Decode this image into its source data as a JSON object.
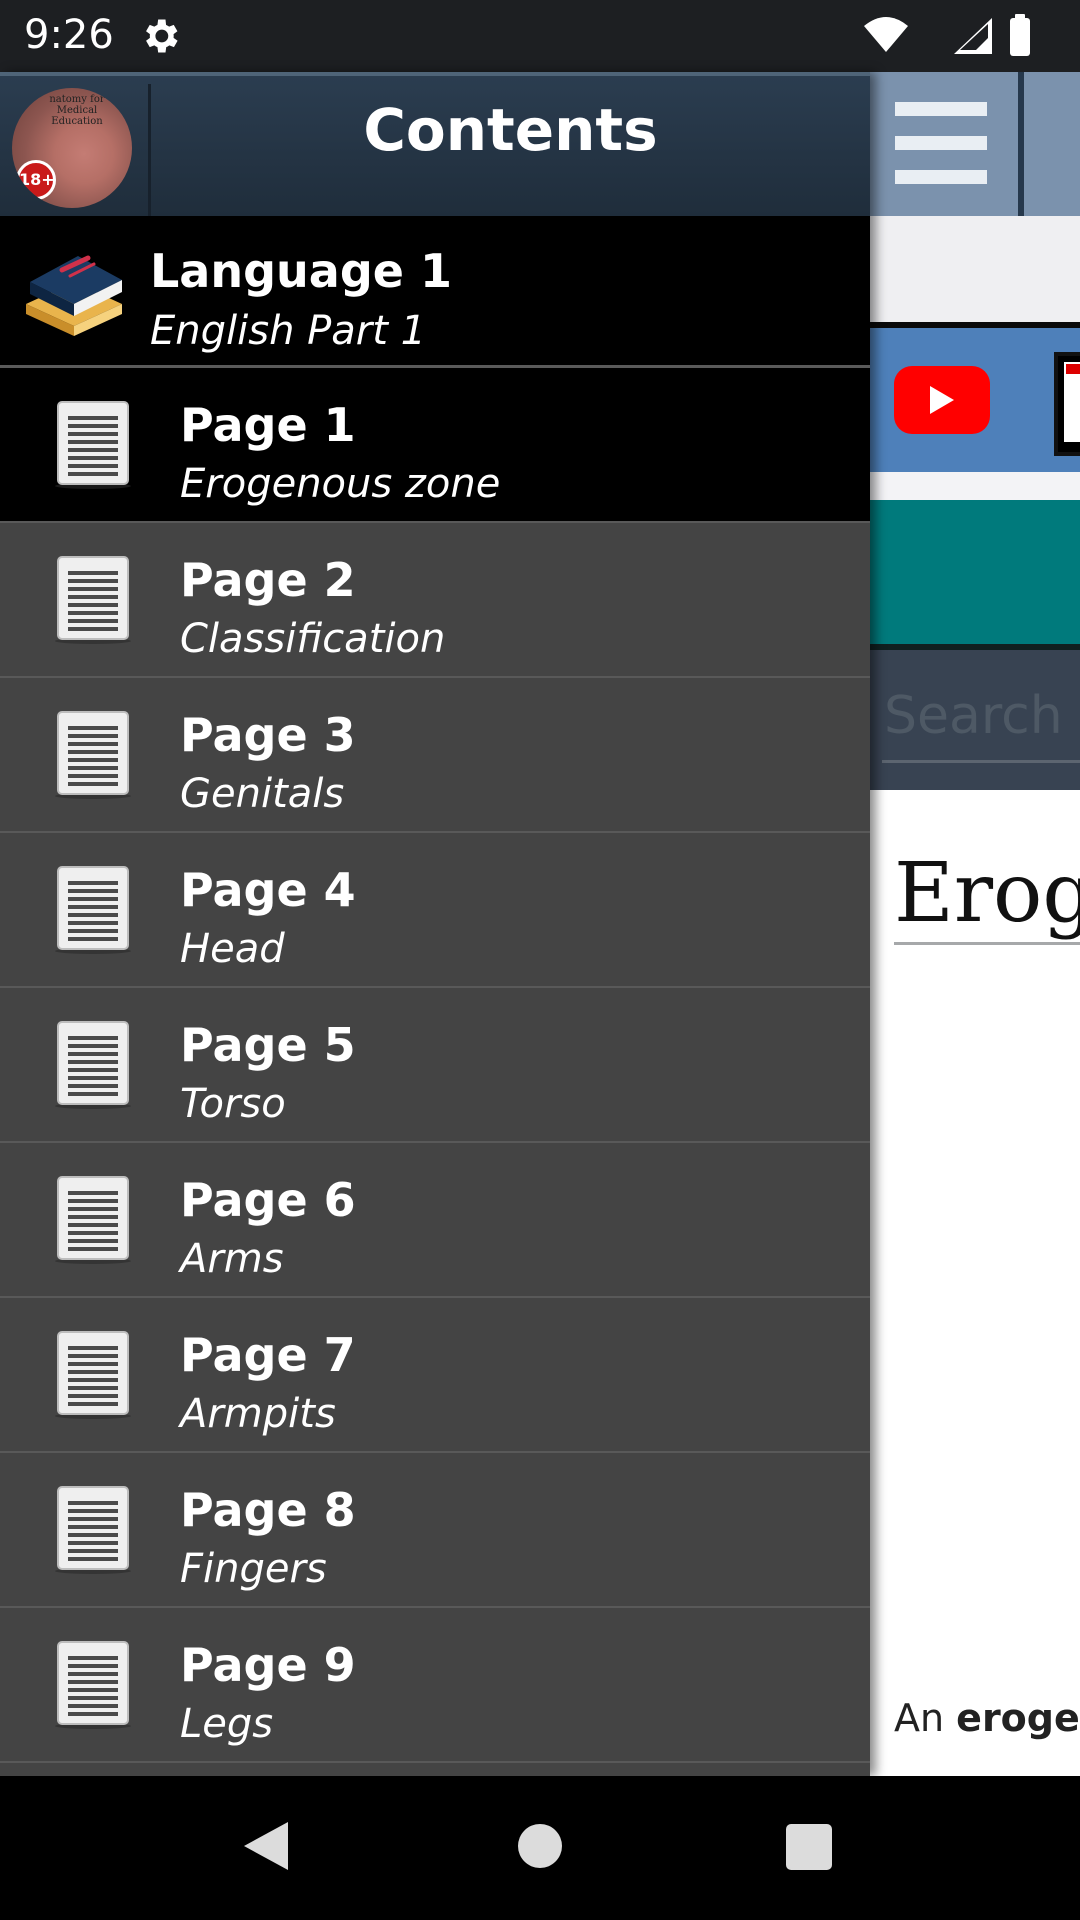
{
  "status_bar": {
    "time": "9:26",
    "icons": [
      "gear-icon",
      "wifi-icon",
      "cellular-signal-icon",
      "battery-icon"
    ]
  },
  "drawer": {
    "title": "Contents",
    "avatar_badge": "18+",
    "avatar_caption": "natomy for Medical Education",
    "group": {
      "title": "Language 1",
      "subtitle": "English Part 1"
    },
    "pages": [
      {
        "title": "Page 1",
        "subtitle": "Erogenous zone",
        "active": true
      },
      {
        "title": "Page 2",
        "subtitle": "Classification"
      },
      {
        "title": "Page 3",
        "subtitle": "Genitals"
      },
      {
        "title": "Page 4",
        "subtitle": "Head"
      },
      {
        "title": "Page 5",
        "subtitle": "Torso"
      },
      {
        "title": "Page 6",
        "subtitle": "Arms"
      },
      {
        "title": "Page 7",
        "subtitle": "Armpits"
      },
      {
        "title": "Page 8",
        "subtitle": "Fingers"
      },
      {
        "title": "Page 9",
        "subtitle": "Legs"
      }
    ]
  },
  "background_page": {
    "search_placeholder": "Search",
    "heading_fragment": "Erog",
    "text_fragment_plain": "An ",
    "text_fragment_bold": "erogen"
  },
  "colors": {
    "drawer_bg": "#444444",
    "active_row": "#000000",
    "header_bg": "#2b3d50",
    "teal": "#007a7c",
    "blue": "#4e80ba"
  }
}
